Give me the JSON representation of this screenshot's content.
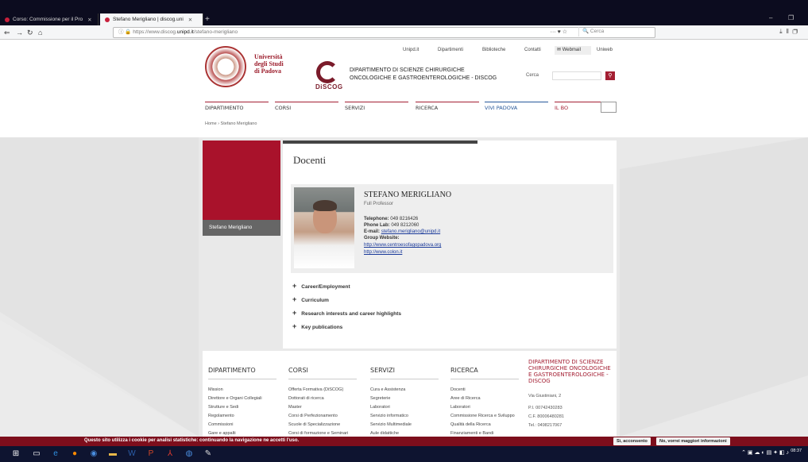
{
  "browser": {
    "tabs": [
      {
        "label": "Corso: Commissione per il Pro",
        "active": false
      },
      {
        "label": "Stefano Merigliano | discog.uni",
        "active": true
      }
    ],
    "url_prefix": "https://www.discog.",
    "url_domain": "unipd.it",
    "url_path": "/stefano-merigliano",
    "search_placeholder": "Cerca"
  },
  "header": {
    "university_name": "Università\ndegli Studi\ndi Padova",
    "discog_logo_text": "DiSCOG",
    "department_name": "Dipartimento di Scienze Chirurgiche\nOncologiche e Gastroenterologiche - DiSCOG",
    "topnav": [
      "Unipd.it",
      "Dipartimenti",
      "Biblioteche",
      "Contatti"
    ],
    "webmail": "Webmail",
    "uniweb": "Uniweb",
    "search_label": "Cerca",
    "mainnav": [
      "Dipartimento",
      "Corsi",
      "Servizi",
      "Ricerca",
      "Vivi Padova",
      "Il Bo"
    ],
    "breadcrumb": "Home › Stefano Merigliano"
  },
  "sidebar": {
    "item": "Stefano Merigliano"
  },
  "content": {
    "title": "Docenti",
    "name": "STEFANO MERIGLIANO",
    "role": "Full Professor",
    "telephone_label": "Telephone:",
    "telephone": "049 8216426",
    "phonelab_label": "Phone Lab:",
    "phonelab": "049 8212060",
    "email_label": "E-mail:",
    "email": "stefano.merigliano@unipd.it",
    "group_label": "Group Website:",
    "link1": "http://www.centroesofagopadova.org",
    "link2": "http://www.colon.it",
    "accordion": [
      "Career/Employment",
      "Curriculum",
      "Research interests and career highlights",
      "Key publications"
    ]
  },
  "footer": {
    "columns": [
      {
        "heading": "Dipartimento",
        "links": [
          "Mission",
          "Direttore e Organi Collegiali",
          "Strutture e Sedi",
          "Regolamento",
          "Commissioni",
          "Gare e appalti"
        ]
      },
      {
        "heading": "Corsi",
        "links": [
          "Offerta Formativa (DiSCOG)",
          "Dottorati di ricerca",
          "Master",
          "Corsi di Perfezionamento",
          "Scuole di Specializzazione",
          "Corsi di formazione e Seminari"
        ]
      },
      {
        "heading": "Servizi",
        "links": [
          "Cura e Assistenza",
          "Segreterie",
          "Laboratori",
          "Servizio informatico",
          "Servizio Multimediale",
          "Aule didattiche"
        ]
      },
      {
        "heading": "Ricerca",
        "links": [
          "Docenti",
          "Aree di Ricerca",
          "Laboratori",
          "Commissione Ricerca e Sviluppo",
          "Qualità della Ricerca",
          "Finanziamenti e Bandi"
        ]
      }
    ],
    "address_heading": "Dipartimento di Scienze Chirurgiche Oncologiche e Gastroenterologiche - DiSCOG",
    "address": "Via Giustiniani, 2",
    "piva": "P.I. 00742430283",
    "cf": "C.F. 80006480281",
    "tel": "Tel.: 0498217067"
  },
  "cookie": {
    "text": "Questo sito utilizza i cookie per analisi statistiche: continuando la navigazione ne accetti l'uso.",
    "accept": "Sì, acconsento",
    "more": "No, vorrei maggiori informazioni"
  },
  "taskbar": {
    "time": "08:37"
  }
}
